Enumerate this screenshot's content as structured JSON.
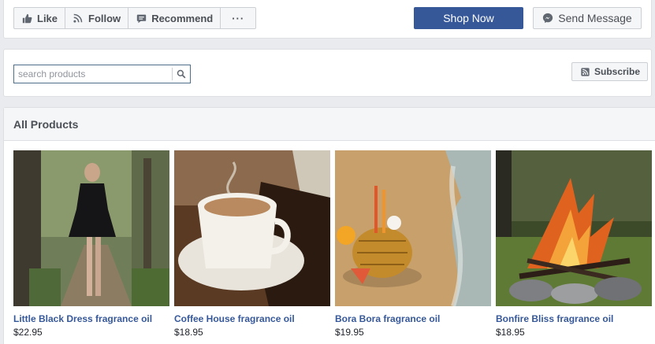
{
  "actions": {
    "like": "Like",
    "follow": "Follow",
    "recommend": "Recommend",
    "more": "···",
    "shop_now": "Shop Now",
    "send_message": "Send Message"
  },
  "search": {
    "placeholder": "search products",
    "value": "",
    "subscribe": "Subscribe"
  },
  "products_panel": {
    "title": "All Products",
    "products": [
      {
        "name": "Little Black Dress fragrance oil",
        "price": "$22.95",
        "image": "woman-in-black-dress-forest"
      },
      {
        "name": "Coffee House fragrance oil",
        "price": "$18.95",
        "image": "coffee-cup-and-beans"
      },
      {
        "name": "Bora Bora fragrance oil",
        "price": "$19.95",
        "image": "pineapple-drink-on-beach"
      },
      {
        "name": "Bonfire Bliss fragrance oil",
        "price": "$18.95",
        "image": "campfire-on-stones"
      }
    ]
  },
  "colors": {
    "brand": "#365899",
    "background": "#e9ebee",
    "button_bg": "#f5f6f7",
    "border": "#dddfe2"
  }
}
